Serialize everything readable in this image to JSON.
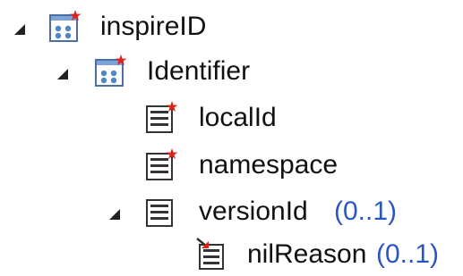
{
  "tree": {
    "nodes": [
      {
        "label": "inspireID",
        "multiplicity": "",
        "icon": "complex-type-required-icon",
        "expanded": true
      },
      {
        "label": "Identifier",
        "multiplicity": "",
        "icon": "complex-type-required-icon",
        "expanded": true
      },
      {
        "label": "localId",
        "multiplicity": "",
        "icon": "attribute-required-icon"
      },
      {
        "label": "namespace",
        "multiplicity": "",
        "icon": "attribute-required-icon"
      },
      {
        "label": "versionId",
        "multiplicity": "(0..1)",
        "icon": "attribute-icon",
        "expanded": true
      },
      {
        "label": "nilReason",
        "multiplicity": "(0..1)",
        "icon": "xml-attribute-icon"
      }
    ]
  },
  "colors": {
    "required_star": "#e0201b",
    "multiplicity_text": "#2a56c4",
    "icon_frame": "#4a6fa5"
  }
}
